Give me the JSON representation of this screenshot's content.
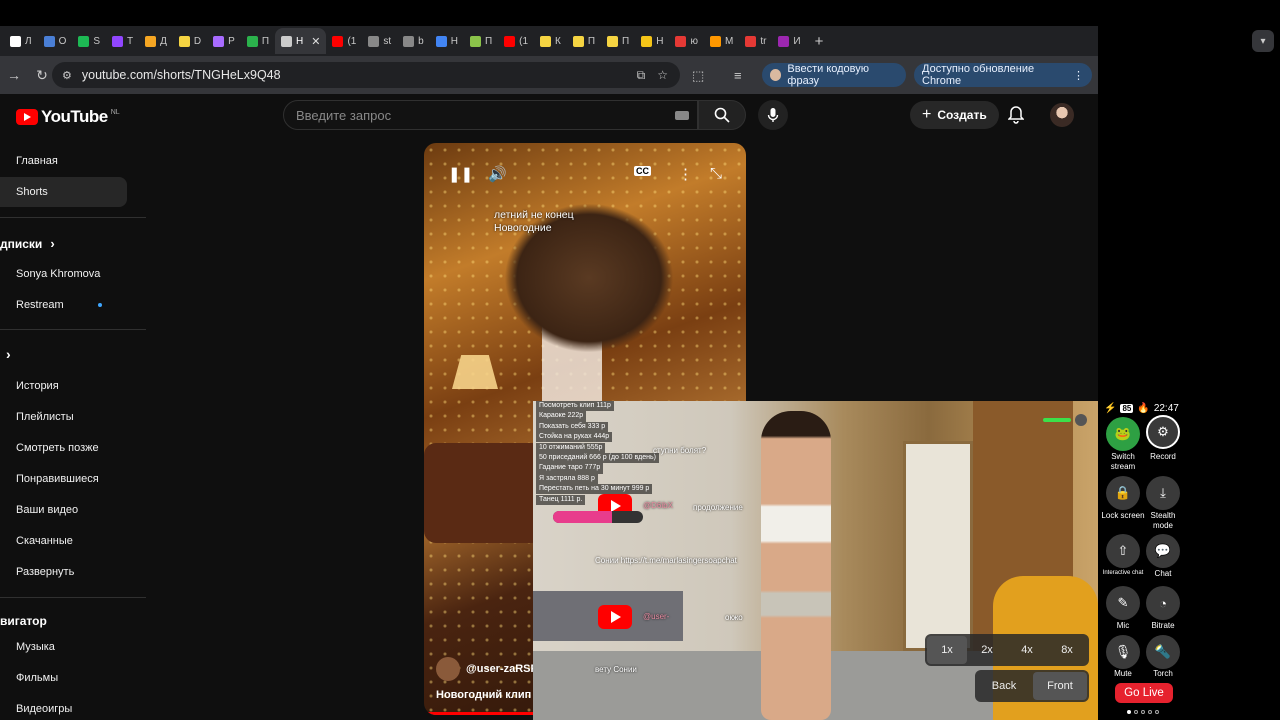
{
  "browser": {
    "tabs": [
      {
        "label": "Л",
        "color": "#ffffff"
      },
      {
        "label": "О",
        "color": "#4a7fd6"
      },
      {
        "label": "S",
        "color": "#1db954"
      },
      {
        "label": "Т",
        "color": "#9146ff"
      },
      {
        "label": "Д",
        "color": "#f5a623"
      },
      {
        "label": "D",
        "color": "#f5d442"
      },
      {
        "label": "Р",
        "color": "#a86bff"
      },
      {
        "label": "П",
        "color": "#2bb24c"
      },
      {
        "label": "Н",
        "color": "#cccccc",
        "active": true
      },
      {
        "label": "(1",
        "color": "#ff0000"
      },
      {
        "label": "st",
        "color": "#888888"
      },
      {
        "label": "b",
        "color": "#888888"
      },
      {
        "label": "Н",
        "color": "#4285f4"
      },
      {
        "label": "П",
        "color": "#8bc34a"
      },
      {
        "label": "(1",
        "color": "#ff0000"
      },
      {
        "label": "К",
        "color": "#f5d442"
      },
      {
        "label": "П",
        "color": "#f5d442"
      },
      {
        "label": "П",
        "color": "#f5d442"
      },
      {
        "label": "Н",
        "color": "#f5c518"
      },
      {
        "label": "ю",
        "color": "#e53935"
      },
      {
        "label": "М",
        "color": "#ff9800"
      },
      {
        "label": "tr",
        "color": "#e53935"
      },
      {
        "label": "И",
        "color": "#9c27b0"
      }
    ],
    "url": "youtube.com/shorts/TNGHeLx9Q48",
    "passphrase_button": "Ввести кодовую фразу",
    "update_button": "Доступно обновление Chrome"
  },
  "youtube": {
    "logo_text": "YouTube",
    "region": "NL",
    "search_placeholder": "Введите запрос",
    "create_label": "Создать",
    "sidebar": {
      "home": "Главная",
      "shorts": "Shorts",
      "subscriptions": "дписки",
      "sub1": "Sonya Khromova",
      "sub2": "Restream",
      "you_chevron": "›",
      "history": "История",
      "playlists": "Плейлисты",
      "watch_later": "Смотреть позже",
      "liked": "Понравившиеся",
      "your_videos": "Ваши видео",
      "downloads": "Скачанные",
      "expand": "Развернуть",
      "navigator": "вигатор",
      "music": "Музыка",
      "movies": "Фильмы",
      "games": "Видеоигры"
    },
    "short": {
      "caption_line1": "летний не конец",
      "caption_line2": "Новогодние",
      "author": "@user-zaRSF",
      "title": "Новогодний клип 2",
      "progress": 0.35
    }
  },
  "stream": {
    "donations": [
      "Посмотреть клип 111р",
      "Караоке 222р",
      "Показать себя 333 р",
      "Стойка на руках 444р",
      "10 отжиманий 555р",
      "50 приседаний 666 р (до 100 вдень)",
      "Гадание таро 777р",
      "Я застряла 888 р",
      "Перестать петь на 30 минут 999 р",
      "Танец 1111 р."
    ],
    "chat_question": "ступни болят?",
    "chat_continue": "продолжение",
    "chat_user1": "@D6ibX",
    "chat_link": "Сонии https://t.me/marlasingersoapchat",
    "chat_user2": "@user-",
    "chat_ok": "окжо",
    "chat_bottom": "вету Сонии",
    "donate_bar_fill": 0.65,
    "zoom": [
      "1x",
      "2x",
      "4x",
      "8x"
    ],
    "zoom_selected": "1x",
    "camera_back": "Back",
    "camera_front": "Front"
  },
  "app_panel": {
    "battery": "85",
    "time": "22:47",
    "switch_stream": "Switch stream",
    "record": "Record",
    "lock_screen": "Lock screen",
    "stealth_mode": "Stealth mode",
    "interactive_chat": "Interactive chat",
    "chat": "Chat",
    "mic": "Mic",
    "bitrate": "Bitrate",
    "mute": "Mute",
    "torch": "Torch",
    "go_live": "Go Live"
  },
  "colors": {
    "yt_red": "#ff0000",
    "go_live": "#e6222e",
    "chrome_pill": "#2a4a6e"
  }
}
